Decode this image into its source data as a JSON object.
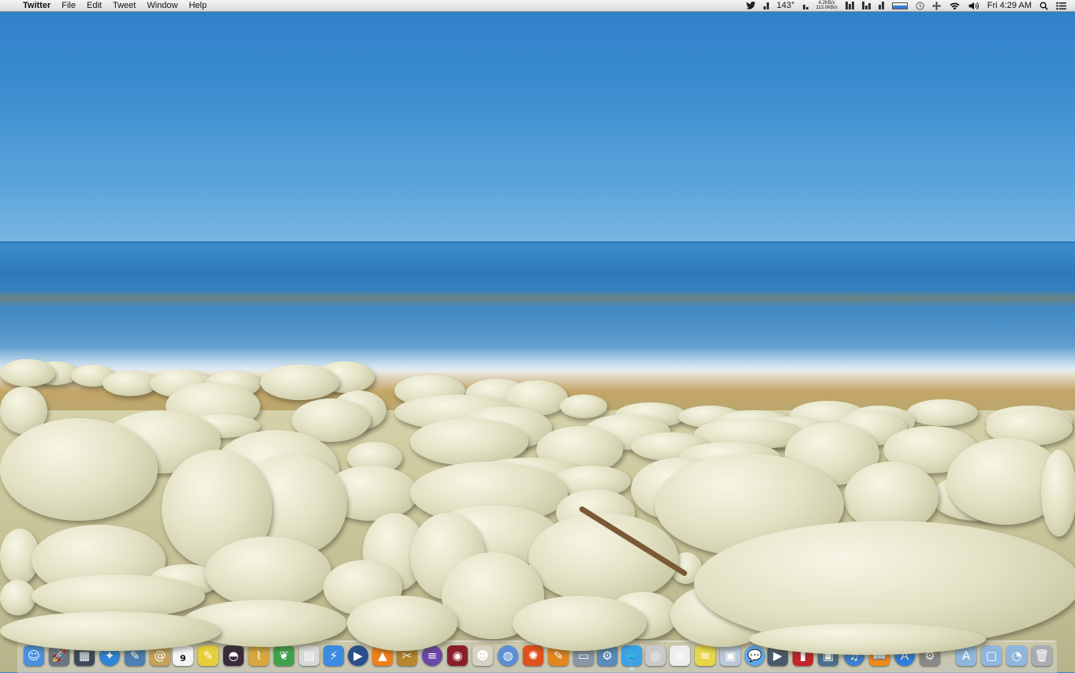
{
  "menubar": {
    "apple_glyph": "",
    "app_name": "Twitter",
    "menus": [
      "File",
      "Edit",
      "Tweet",
      "Window",
      "Help"
    ],
    "status": {
      "temperature": "143°",
      "net_up": "4.2KB/s",
      "net_down": "113.0KB/s",
      "clock": "Fri 4:29 AM"
    }
  },
  "dock": {
    "items": [
      {
        "name": "finder",
        "icon": "finder-icon",
        "color": "#4a8fe0",
        "glyph": "☺"
      },
      {
        "name": "launchpad",
        "icon": "rocket-icon",
        "color": "#6d7580",
        "glyph": "🚀"
      },
      {
        "name": "mission-control",
        "icon": "mission-control-icon",
        "color": "#3c4a5a",
        "glyph": "▦"
      },
      {
        "name": "safari",
        "icon": "compass-icon",
        "color": "#2f86d8",
        "glyph": "✦"
      },
      {
        "name": "preview",
        "icon": "preview-icon",
        "color": "#4f7eb0",
        "glyph": "✎"
      },
      {
        "name": "contacts",
        "icon": "address-book-icon",
        "color": "#c6a15c",
        "glyph": "@"
      },
      {
        "name": "calendar",
        "icon": "calendar-icon",
        "color": "#f4f4f4",
        "glyph": "9"
      },
      {
        "name": "stickies",
        "icon": "stickies-icon",
        "color": "#e6cf3b",
        "glyph": "✎"
      },
      {
        "name": "alfred",
        "icon": "bowler-hat-icon",
        "color": "#3a2a3a",
        "glyph": "◓"
      },
      {
        "name": "clipboard",
        "icon": "paperclip-icon",
        "color": "#d7a83d",
        "glyph": "⌇"
      },
      {
        "name": "evernote",
        "icon": "elephant-icon",
        "color": "#3fa34d",
        "glyph": "❦"
      },
      {
        "name": "notebook",
        "icon": "notebook-icon",
        "color": "#d8d8d8",
        "glyph": "▤"
      },
      {
        "name": "lightning",
        "icon": "lightning-icon",
        "color": "#3b8be0",
        "glyph": "⚡"
      },
      {
        "name": "quicktime",
        "icon": "play-icon",
        "color": "#2a4f8a",
        "glyph": "▶"
      },
      {
        "name": "vlc",
        "icon": "traffic-cone-icon",
        "color": "#f07f1a",
        "glyph": "▲"
      },
      {
        "name": "photo-editor",
        "icon": "photo-edit-icon",
        "color": "#b8862e",
        "glyph": "✂"
      },
      {
        "name": "server",
        "icon": "database-icon",
        "color": "#6b47a8",
        "glyph": "≡"
      },
      {
        "name": "photo-booth",
        "icon": "camera-lens-icon",
        "color": "#8a1f2a",
        "glyph": "◉"
      },
      {
        "name": "face-app",
        "icon": "face-icon",
        "color": "#d9d1c4",
        "glyph": "☻"
      },
      {
        "name": "chrome",
        "icon": "browser-icon",
        "color": "#5b8ed6",
        "glyph": "◍"
      },
      {
        "name": "firefox",
        "icon": "flame-icon",
        "color": "#e0521c",
        "glyph": "✺"
      },
      {
        "name": "pages",
        "icon": "document-icon",
        "color": "#e2871f",
        "glyph": "✎"
      },
      {
        "name": "remote-desktop",
        "icon": "monitor-icon",
        "color": "#8696a8",
        "glyph": "▭"
      },
      {
        "name": "system-info",
        "icon": "tools-icon",
        "color": "#5a8ab8",
        "glyph": "⚙"
      },
      {
        "name": "twitter",
        "icon": "bird-icon",
        "color": "#3aa2e8",
        "glyph": "🐦",
        "running": true
      },
      {
        "name": "glasses-app",
        "icon": "glasses-icon",
        "color": "#c9c9c9",
        "glyph": "◎"
      },
      {
        "name": "text-edit",
        "icon": "text-edit-icon",
        "color": "#ededed",
        "glyph": "≣"
      },
      {
        "name": "notes",
        "icon": "notes-icon",
        "color": "#e8d64a",
        "glyph": "≡"
      },
      {
        "name": "preview-photos",
        "icon": "photos-icon",
        "color": "#b9c9d8",
        "glyph": "▣"
      },
      {
        "name": "messages",
        "icon": "speech-bubble-icon",
        "color": "#5aa8e8",
        "glyph": "💬"
      },
      {
        "name": "facetime",
        "icon": "video-camera-icon",
        "color": "#4a5a6a",
        "glyph": "▶"
      },
      {
        "name": "photo-booth-red",
        "icon": "red-booth-icon",
        "color": "#c4242a",
        "glyph": "▮"
      },
      {
        "name": "iphoto",
        "icon": "camera-icon",
        "color": "#4c6f8d",
        "glyph": "▣"
      },
      {
        "name": "itunes",
        "icon": "music-note-icon",
        "color": "#3b7fd6",
        "glyph": "♫"
      },
      {
        "name": "ibooks",
        "icon": "book-icon",
        "color": "#f08a1d",
        "glyph": "📖"
      },
      {
        "name": "app-store",
        "icon": "app-store-icon",
        "color": "#2f7fe0",
        "glyph": "A"
      },
      {
        "name": "system-preferences",
        "icon": "gear-icon",
        "color": "#8a8a8a",
        "glyph": "⚙"
      },
      {
        "name": "applications-folder",
        "icon": "folder-icon",
        "color": "#8fb6dd",
        "glyph": "A"
      },
      {
        "name": "documents-folder",
        "icon": "folder-icon",
        "color": "#8fb6dd",
        "glyph": "▢"
      },
      {
        "name": "downloads-folder",
        "icon": "folder-icon",
        "color": "#8fb6dd",
        "glyph": "◔"
      },
      {
        "name": "trash",
        "icon": "trash-icon",
        "color": "#a9adb2",
        "glyph": "🗑"
      }
    ]
  }
}
